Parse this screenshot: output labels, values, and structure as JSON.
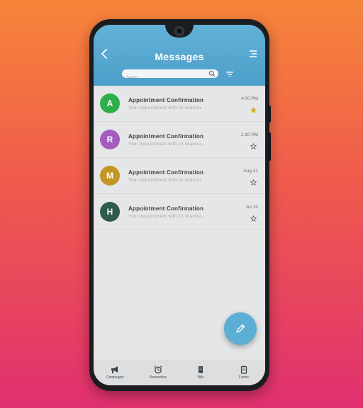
{
  "header": {
    "title": "Messages",
    "search_placeholder": "Search..."
  },
  "messages": [
    {
      "initial": "A",
      "color": "#2fae4a",
      "subject": "Appointment Confirmation",
      "preview": "Your Appointment with Dr.sharma...",
      "time": "4:00 PM",
      "starred": true
    },
    {
      "initial": "R",
      "color": "#a35dbf",
      "subject": "Appointment Confirmation",
      "preview": "Your Appointment with Dr.sharma...",
      "time": "2:30 PM",
      "starred": false
    },
    {
      "initial": "M",
      "color": "#c39524",
      "subject": "Appointment Confirmation",
      "preview": "Your Appointment with Dr.sharma...",
      "time": "Aug 21",
      "starred": false
    },
    {
      "initial": "H",
      "color": "#2f5b4c",
      "subject": "Appointment Confirmation",
      "preview": "Your Appointment with Dr.sharma...",
      "time": "Jul 10",
      "starred": false
    }
  ],
  "bottom_nav": {
    "items": [
      {
        "label": "Campaigns",
        "icon": "megaphone-icon"
      },
      {
        "label": "Reminders",
        "icon": "alarm-clock-icon"
      },
      {
        "label": "Bills",
        "icon": "receipt-icon"
      },
      {
        "label": "Forms",
        "icon": "clipboard-icon"
      }
    ]
  },
  "colors": {
    "header": "#5aa9d2",
    "accent": "#5bafd4",
    "star_active": "#d9b22a"
  }
}
